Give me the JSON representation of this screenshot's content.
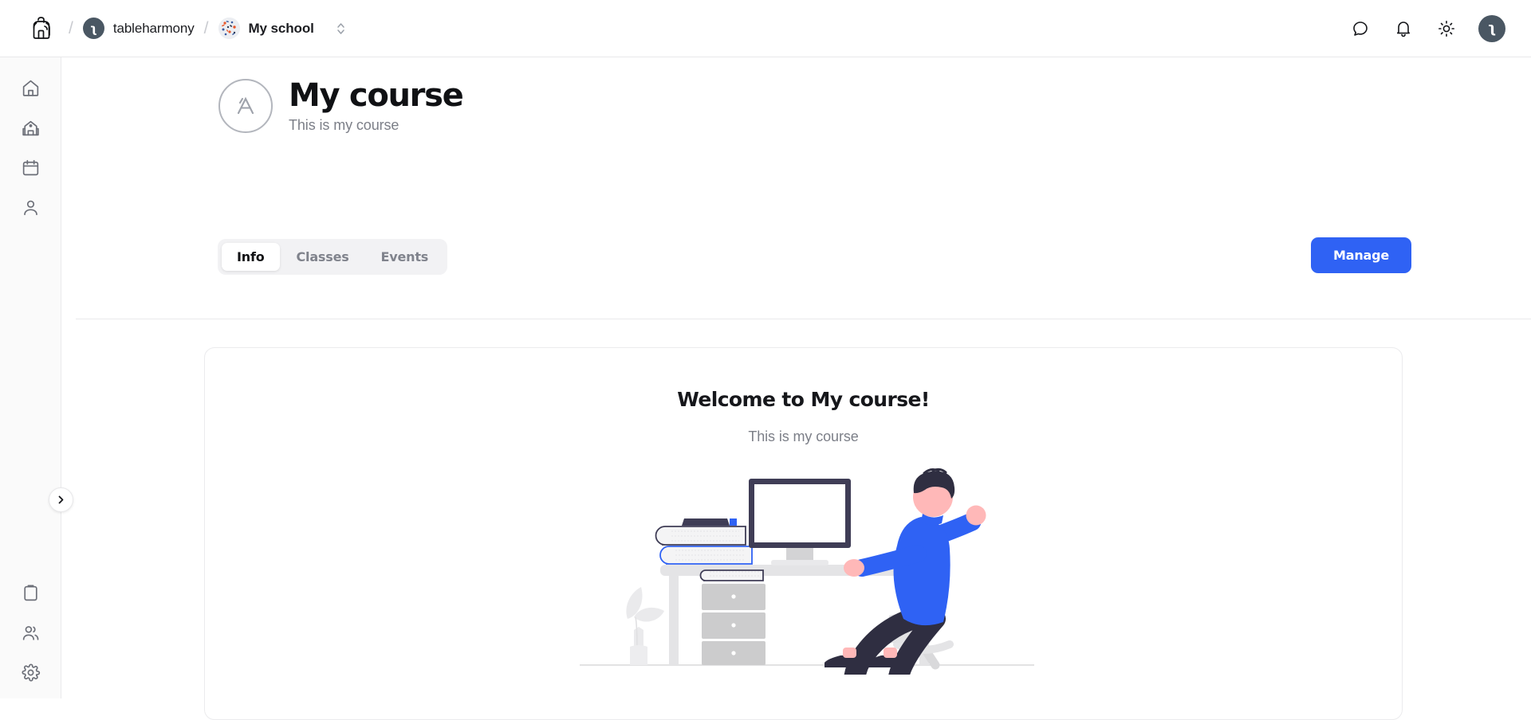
{
  "topbar": {
    "logo_icon": "backpack-logo-icon",
    "breadcrumb": {
      "separator": "/",
      "org": {
        "label": "tableharmony",
        "avatar_initial": "ʅ",
        "avatar_icon": "org-avatar"
      },
      "school": {
        "label": "My school",
        "avatar_icon": "school-avatar-confetti",
        "switcher_icon": "chevron-up-down-icon"
      }
    },
    "actions": [
      {
        "name": "chat-icon",
        "title": "Messages"
      },
      {
        "name": "bell-icon",
        "title": "Notifications"
      },
      {
        "name": "sun-icon",
        "title": "Toggle theme"
      }
    ],
    "user_avatar": {
      "name": "user-avatar",
      "initial": "ʅ"
    }
  },
  "sidebar": {
    "top_items": [
      {
        "name": "sidebar-item-home",
        "icon": "home-icon",
        "label": "Home"
      },
      {
        "name": "sidebar-item-school",
        "icon": "school-icon",
        "label": "School"
      },
      {
        "name": "sidebar-item-calendar",
        "icon": "calendar-icon",
        "label": "Calendar"
      },
      {
        "name": "sidebar-item-profile",
        "icon": "user-icon",
        "label": "Profile"
      }
    ],
    "bottom_items": [
      {
        "name": "sidebar-item-courses",
        "icon": "clipboard-icon",
        "label": "Courses"
      },
      {
        "name": "sidebar-item-members",
        "icon": "users-icon",
        "label": "Members"
      },
      {
        "name": "sidebar-item-settings",
        "icon": "gear-icon",
        "label": "Settings"
      }
    ],
    "toggle": {
      "name": "sidebar-expand-toggle",
      "icon": "chevron-right-icon"
    }
  },
  "course": {
    "avatar_icon": "appstore-a-icon",
    "title": "My course",
    "subtitle": "This is my course"
  },
  "tabs": [
    {
      "label": "Info",
      "active": true
    },
    {
      "label": "Classes",
      "active": false
    },
    {
      "label": "Events",
      "active": false
    }
  ],
  "actions": {
    "manage_label": "Manage"
  },
  "welcome": {
    "title": "Welcome to My course!",
    "subtitle": "This is my course",
    "illustration": "person-at-desk-with-computer-illustration"
  },
  "colors": {
    "accent_blue": "#2f62f4",
    "illustration_blue": "#2f62f4",
    "dark_navy": "#3f3d56",
    "skin": "#ffb8b8",
    "gray_light": "#e6e6e6",
    "gray_mid": "#cccccc",
    "page_bg": "#ffffff",
    "sidebar_bg": "#fafafa",
    "border": "#ebebed",
    "muted_text": "#7c7f88"
  }
}
